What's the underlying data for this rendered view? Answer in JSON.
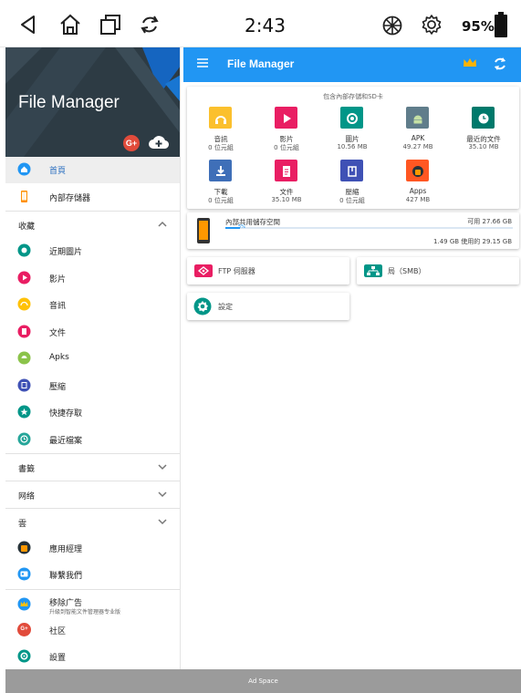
{
  "status_bar": {
    "time": "2:43",
    "battery": "95%"
  },
  "drawer": {
    "title": "File Manager",
    "nav_top": [
      {
        "label": "首頁",
        "icon": "home-icon",
        "color": "#2196f3",
        "active": true
      },
      {
        "label": "內部存儲器",
        "icon": "phone-icon",
        "color": "#ff8f00",
        "active": false
      }
    ],
    "section_favorites": "收藏",
    "favorites": [
      {
        "label": "近期圖片",
        "icon": "camera-icon",
        "color": "#009688"
      },
      {
        "label": "影片",
        "icon": "play-icon",
        "color": "#e91e63"
      },
      {
        "label": "音訊",
        "icon": "headphones-icon",
        "color": "#ffc107"
      },
      {
        "label": "文件",
        "icon": "document-icon",
        "color": "#e91e63"
      },
      {
        "label": "Apks",
        "icon": "android-icon",
        "color": "#8bc34a"
      },
      {
        "label": "壓縮",
        "icon": "archive-icon",
        "color": "#3f51b5"
      },
      {
        "label": "快捷存取",
        "icon": "star-icon",
        "color": "#009688"
      },
      {
        "label": "最近檔案",
        "icon": "clock-icon",
        "color": "#26a69a"
      }
    ],
    "section_bookmarks": "書籤",
    "section_network": "网络",
    "section_cloud": "雲",
    "bottom_items": [
      {
        "label": "應用經理",
        "icon": "app-manager-icon",
        "color": "#ff5722"
      },
      {
        "label": "聯繫我們",
        "icon": "contact-icon",
        "color": "#2196f3"
      }
    ],
    "footer_items": [
      {
        "label": "移除广告",
        "sub": "升級到智能文件管理器专业版",
        "icon": "crown-icon",
        "color": "#2196f3"
      },
      {
        "label": "社区",
        "icon": "google-plus-icon",
        "color": "#e14b3b"
      },
      {
        "label": "設置",
        "icon": "gear-icon",
        "color": "#009688"
      }
    ]
  },
  "appbar": {
    "title": "File Manager"
  },
  "categories": {
    "caption": "包含內部存儲和SD卡",
    "tiles": [
      {
        "name": "音訊",
        "size": "0 位元組",
        "icon": "headphones-icon",
        "color": "#fbc02d"
      },
      {
        "name": "影片",
        "size": "0 位元組",
        "icon": "play-icon",
        "color": "#e91e63"
      },
      {
        "name": "圖片",
        "size": "10.56 MB",
        "icon": "camera-icon",
        "color": "#009688"
      },
      {
        "name": "APK",
        "size": "49.27 MB",
        "icon": "android-icon",
        "color": "#607d8b"
      },
      {
        "name": "最近的文件",
        "size": "35.10 MB",
        "icon": "clock-icon",
        "color": "#00796b"
      },
      {
        "name": "下載",
        "size": "0 位元組",
        "icon": "download-icon",
        "color": "#3f6fb8"
      },
      {
        "name": "文件",
        "size": "35.10 MB",
        "icon": "document-icon",
        "color": "#e91e63"
      },
      {
        "name": "壓縮",
        "size": "0 位元組",
        "icon": "archive-icon",
        "color": "#3f51b5"
      },
      {
        "name": "Apps",
        "size": "427 MB",
        "icon": "apps-icon",
        "color": "#ff5722"
      }
    ]
  },
  "storage": {
    "title": "內部共用儲存空間",
    "free": "可用 27.66 GB",
    "used": "1.49 GB 使用的 29.15 GB",
    "percent_label": "5%",
    "used_fraction": 0.05
  },
  "shortcuts": {
    "ftp": "FTP 伺服器",
    "lan": "局（SMB）",
    "settings": "設定"
  },
  "ad": {
    "label": "Ad Space"
  }
}
